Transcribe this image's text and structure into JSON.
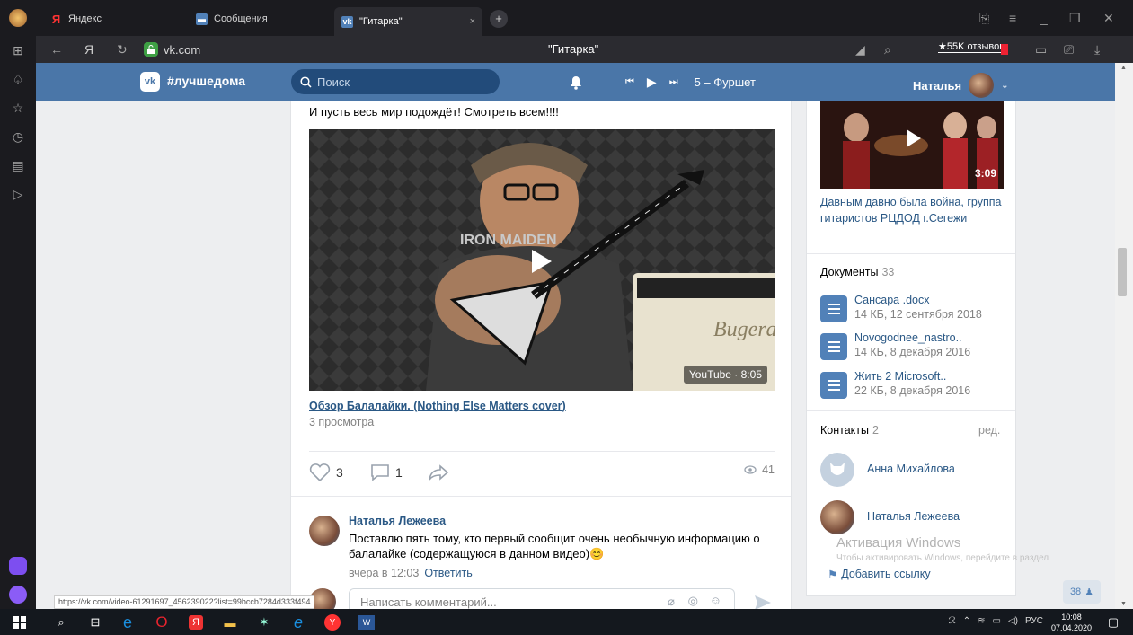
{
  "browser": {
    "tabs": [
      {
        "label": "Яндекс",
        "icon": "yandex-icon"
      },
      {
        "label": "Сообщения",
        "icon": "messages-icon"
      },
      {
        "label": "\"Гитарка\"",
        "icon": "vk-icon",
        "active": true
      }
    ],
    "url": "vk.com",
    "page_title": "\"Гитарка\"",
    "reviews_badge": "★55K отзывов",
    "status_url": "https://vk.com/video-61291697_456239022?list=99bccb7284d333f494"
  },
  "vk": {
    "header_tag": "#лучшедома",
    "logo": "vk",
    "search_placeholder": "Поиск",
    "track": "5 – Фуршет",
    "user_name": "Наталья"
  },
  "post": {
    "text": "И пусть весь мир подождёт! Смотреть всем!!!!",
    "video": {
      "title": "Обзор Балалайки. (Nothing Else Matters cover)",
      "views": "3 просмотра",
      "badge": "YouTube · 8:05",
      "shirt_text": "IRON MAIDEN",
      "amp_brand": "Bugera"
    },
    "likes": "3",
    "comments": "1",
    "view_count": "41",
    "comment": {
      "author": "Наталья Лежеева",
      "text": "Поставлю пять тому, кто первый сообщит очень необычную информацию о балалайке (содержащуюся в данном видео)😊",
      "time": "вчера в 12:03",
      "reply": "Ответить"
    },
    "comment_placeholder": "Написать комментарий..."
  },
  "right": {
    "video_duration": "3:09",
    "video_title": "Давным давно была война, группа гитаристов РЦДОД г.Сегежи",
    "docs_header": "Документы",
    "docs_count": "33",
    "docs": [
      {
        "name": "Сансара .docx",
        "meta": "14 КБ, 12 сентября 2018"
      },
      {
        "name": "Novogodnee_nastro..",
        "meta": "14 КБ, 8 декабря 2016"
      },
      {
        "name": "Жить 2 Microsoft..",
        "meta": "22 КБ, 8 декабря 2016"
      }
    ],
    "contacts_header": "Контакты",
    "contacts_count": "2",
    "edit": "ред.",
    "contacts": [
      {
        "name": "Анна Михайлова"
      },
      {
        "name": "Наталья Лежеева"
      }
    ],
    "add_link": "Добавить ссылку"
  },
  "windows": {
    "activation_title": "Активация Windows",
    "activation_text": "Чтобы активировать Windows, перейдите в раздел",
    "online_count": "38",
    "time": "10:08",
    "date": "07.04.2020",
    "lang": "РУС"
  },
  "colors": {
    "vk_blue": "#4a76a8",
    "link": "#2a5885",
    "muted": "#828282"
  }
}
